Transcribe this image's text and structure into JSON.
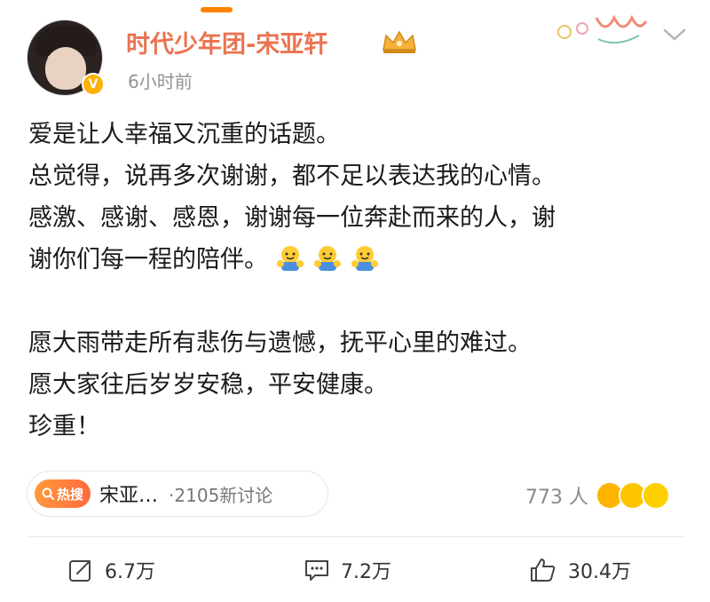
{
  "post": {
    "author": "时代少年团-宋亚轩",
    "time": "6小时前",
    "verified_badge": "V",
    "lines": [
      "爱是让人幸福又沉重的话题。",
      "总觉得，说再多次谢谢，都不足以表达我的心情。",
      "感激、感谢、感恩，谢谢每一位奔赴而来的人，谢",
      "谢你们每一程的陪伴。"
    ],
    "lines2": [
      "愿大雨带走所有悲伤与遗憾，抚平心里的难过。",
      "愿大家往后岁岁安稳，平安健康。",
      "珍重！"
    ]
  },
  "topic": {
    "hot_label": "热搜",
    "name": "宋亚…",
    "discussions": "·2105新讨论"
  },
  "reactions": {
    "count": "773 人"
  },
  "actions": {
    "repost": "6.7万",
    "comment": "7.2万",
    "like": "30.4万"
  },
  "colors": {
    "accent": "#ff8200",
    "username": "#eb7350",
    "muted": "#939393"
  },
  "icons": [
    "crown-icon",
    "sticker-icon",
    "chevron-down-icon",
    "hug-emoji-icon",
    "search-icon",
    "repost-icon",
    "comment-icon",
    "like-icon"
  ]
}
